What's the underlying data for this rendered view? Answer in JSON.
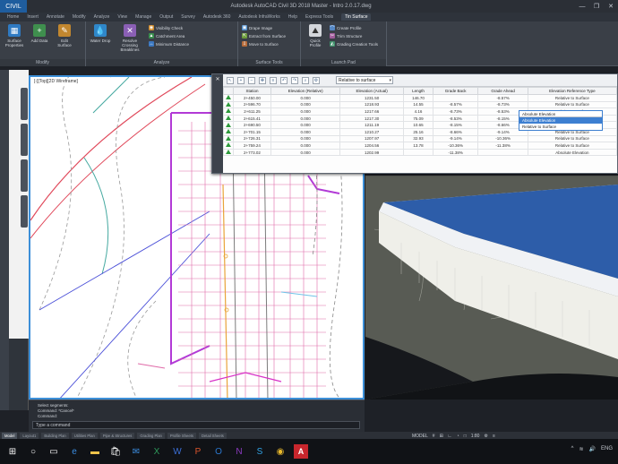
{
  "title_bar": {
    "app_button": "CIVIL",
    "window_title": "Autodesk AutoCAD Civil 3D 2018   Master - Intro 2.0.17.dwg",
    "controls": [
      "—",
      "❐",
      "✕"
    ]
  },
  "ribbon_tabs": [
    "Home",
    "Insert",
    "Annotate",
    "Modify",
    "Analyze",
    "View",
    "Manage",
    "Output",
    "Survey",
    "Autodesk 360",
    "Autodesk InfraWorks",
    "Help",
    "Express Tools",
    "Tin Surface"
  ],
  "ribbon_active_tab": "Tin Surface",
  "ribbon_panels": {
    "modify": {
      "footer": "Modify",
      "buttons": [
        "Surface Properties",
        "Add Data",
        "Edit Surface"
      ]
    },
    "analyze": {
      "footer": "Analyze",
      "buttons": [
        "Water Drop",
        "Resolve Crossing Breaklines"
      ],
      "small": [
        "Visibility Check",
        "Catchment Area",
        "Minimum Distance"
      ]
    },
    "surface_tools": {
      "footer": "Surface Tools",
      "small": [
        "Drape Image",
        "Extract from Surface",
        "Move to Surface"
      ]
    },
    "launch_pad": {
      "footer": "Launch Pad",
      "buttons": [
        "Quick Profile"
      ],
      "small": [
        "Create Profile",
        "Trim Structure",
        "Grading Creation Tools"
      ]
    }
  },
  "viewport_plan": {
    "label": "[-][Top][2D Wireframe]"
  },
  "profile_grid": {
    "relative_selector": "Relative to surface",
    "columns": [
      "",
      "Station",
      "Elevation (Relative)",
      "Elevation (Actual)",
      "Length",
      "Grade Back",
      "Grade Ahead",
      "Elevation Reference Type"
    ],
    "rows": [
      [
        "",
        "2+450.00",
        "0.000",
        "1231.50",
        "146.70",
        "",
        "-8.57%",
        "Relative to Surface"
      ],
      [
        "",
        "2+596.70",
        "0.000",
        "1218.93",
        "14.55",
        "-8.57%",
        "-8.73%",
        "Relative to Surface"
      ],
      [
        "",
        "2+611.25",
        "0.000",
        "1217.66",
        "4.16",
        "-8.73%",
        "-8.53%",
        "Relative to Surface"
      ],
      [
        "",
        "2+615.41",
        "0.000",
        "1217.30",
        "75.09",
        "-8.53%",
        "-8.15%",
        "Relative to Surface"
      ],
      [
        "",
        "2+690.50",
        "0.000",
        "1211.19",
        "10.65",
        "-8.15%",
        "-8.66%",
        "Relative to Surface"
      ],
      [
        "",
        "2+701.15",
        "0.000",
        "1210.27",
        "25.16",
        "-8.66%",
        "-9.14%",
        "Relative to Surface"
      ],
      [
        "",
        "2+726.31",
        "0.000",
        "1207.97",
        "32.93",
        "-9.14%",
        "-10.36%",
        "Relative to Surface"
      ],
      [
        "",
        "2+759.24",
        "0.000",
        "1204.56",
        "13.78",
        "-10.36%",
        "-11.38%",
        "Relative to Surface"
      ],
      [
        "",
        "2+773.02",
        "0.000",
        "1202.99",
        "",
        "-11.38%",
        "",
        "Absolute Elevation"
      ]
    ],
    "dropdown_options": [
      "Absolute Elevation",
      "Relative to Surface"
    ],
    "dropdown_selected": "Absolute Elevation"
  },
  "command_line": {
    "history": [
      "Select segments:",
      "Command: *Cancel*",
      "Command:"
    ],
    "prompt": "Type a command"
  },
  "layout_tabs": [
    "Model",
    "Layout1",
    "Building Plan",
    "Utilities Plan",
    "Pipe & Structures",
    "Grading Plan",
    "Profile Sheets",
    "Detail Sheets"
  ],
  "layout_active": "Model",
  "status": {
    "zoom": "1:80",
    "scale_label": "1\" = 40'"
  },
  "taskbar_apps": [
    "start-icon",
    "search-icon",
    "task-view-icon",
    "edge-icon",
    "explorer-icon",
    "store-icon",
    "mail-icon",
    "excel-icon",
    "word-icon",
    "powerpoint-icon",
    "outlook-icon",
    "onenote-icon",
    "skype-icon",
    "chrome-icon",
    "autocad-icon"
  ],
  "tray": [
    "^",
    "≋",
    "🔊",
    "ENG"
  ]
}
